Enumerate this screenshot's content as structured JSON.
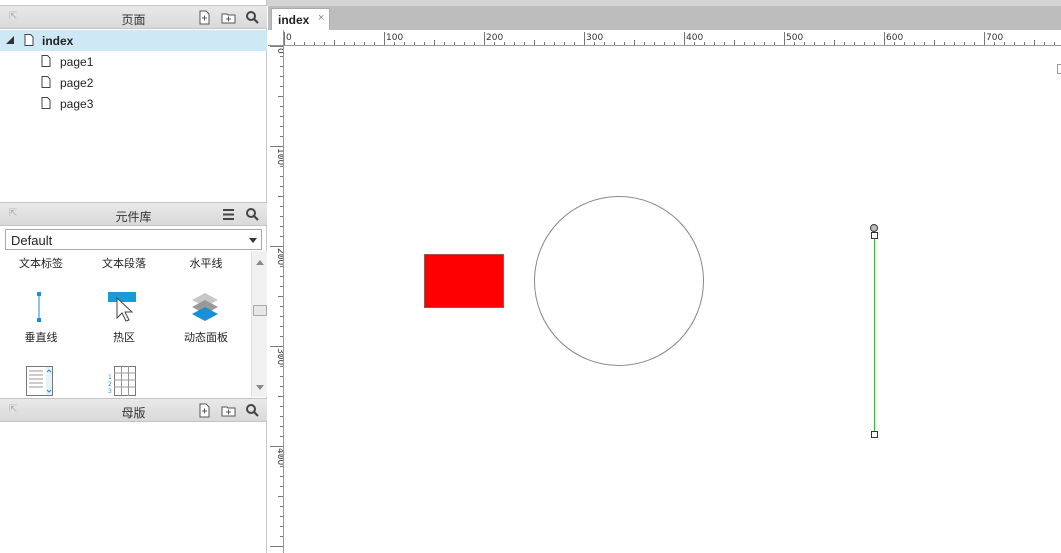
{
  "pages_panel": {
    "title": "页面",
    "items": [
      {
        "label": "index",
        "selected": true
      },
      {
        "label": "page1"
      },
      {
        "label": "page2"
      },
      {
        "label": "page3"
      }
    ]
  },
  "library_panel": {
    "title": "元件库",
    "selected_library": "Default",
    "widgets_row1": [
      "文本标签",
      "文本段落",
      "水平线"
    ],
    "widgets_row2": [
      "垂直线",
      "热区",
      "动态面板"
    ]
  },
  "masters_panel": {
    "title": "母版"
  },
  "tabs": [
    {
      "label": "index",
      "close": "×"
    }
  ],
  "ruler": {
    "h_labels": [
      "0",
      "100",
      "200",
      "300",
      "400",
      "500",
      "600",
      "700"
    ],
    "v_labels": [
      "0",
      "100",
      "200",
      "300",
      "400"
    ]
  },
  "canvas": {
    "rect_color": "#ff0000",
    "line_color": "#33bb33"
  }
}
